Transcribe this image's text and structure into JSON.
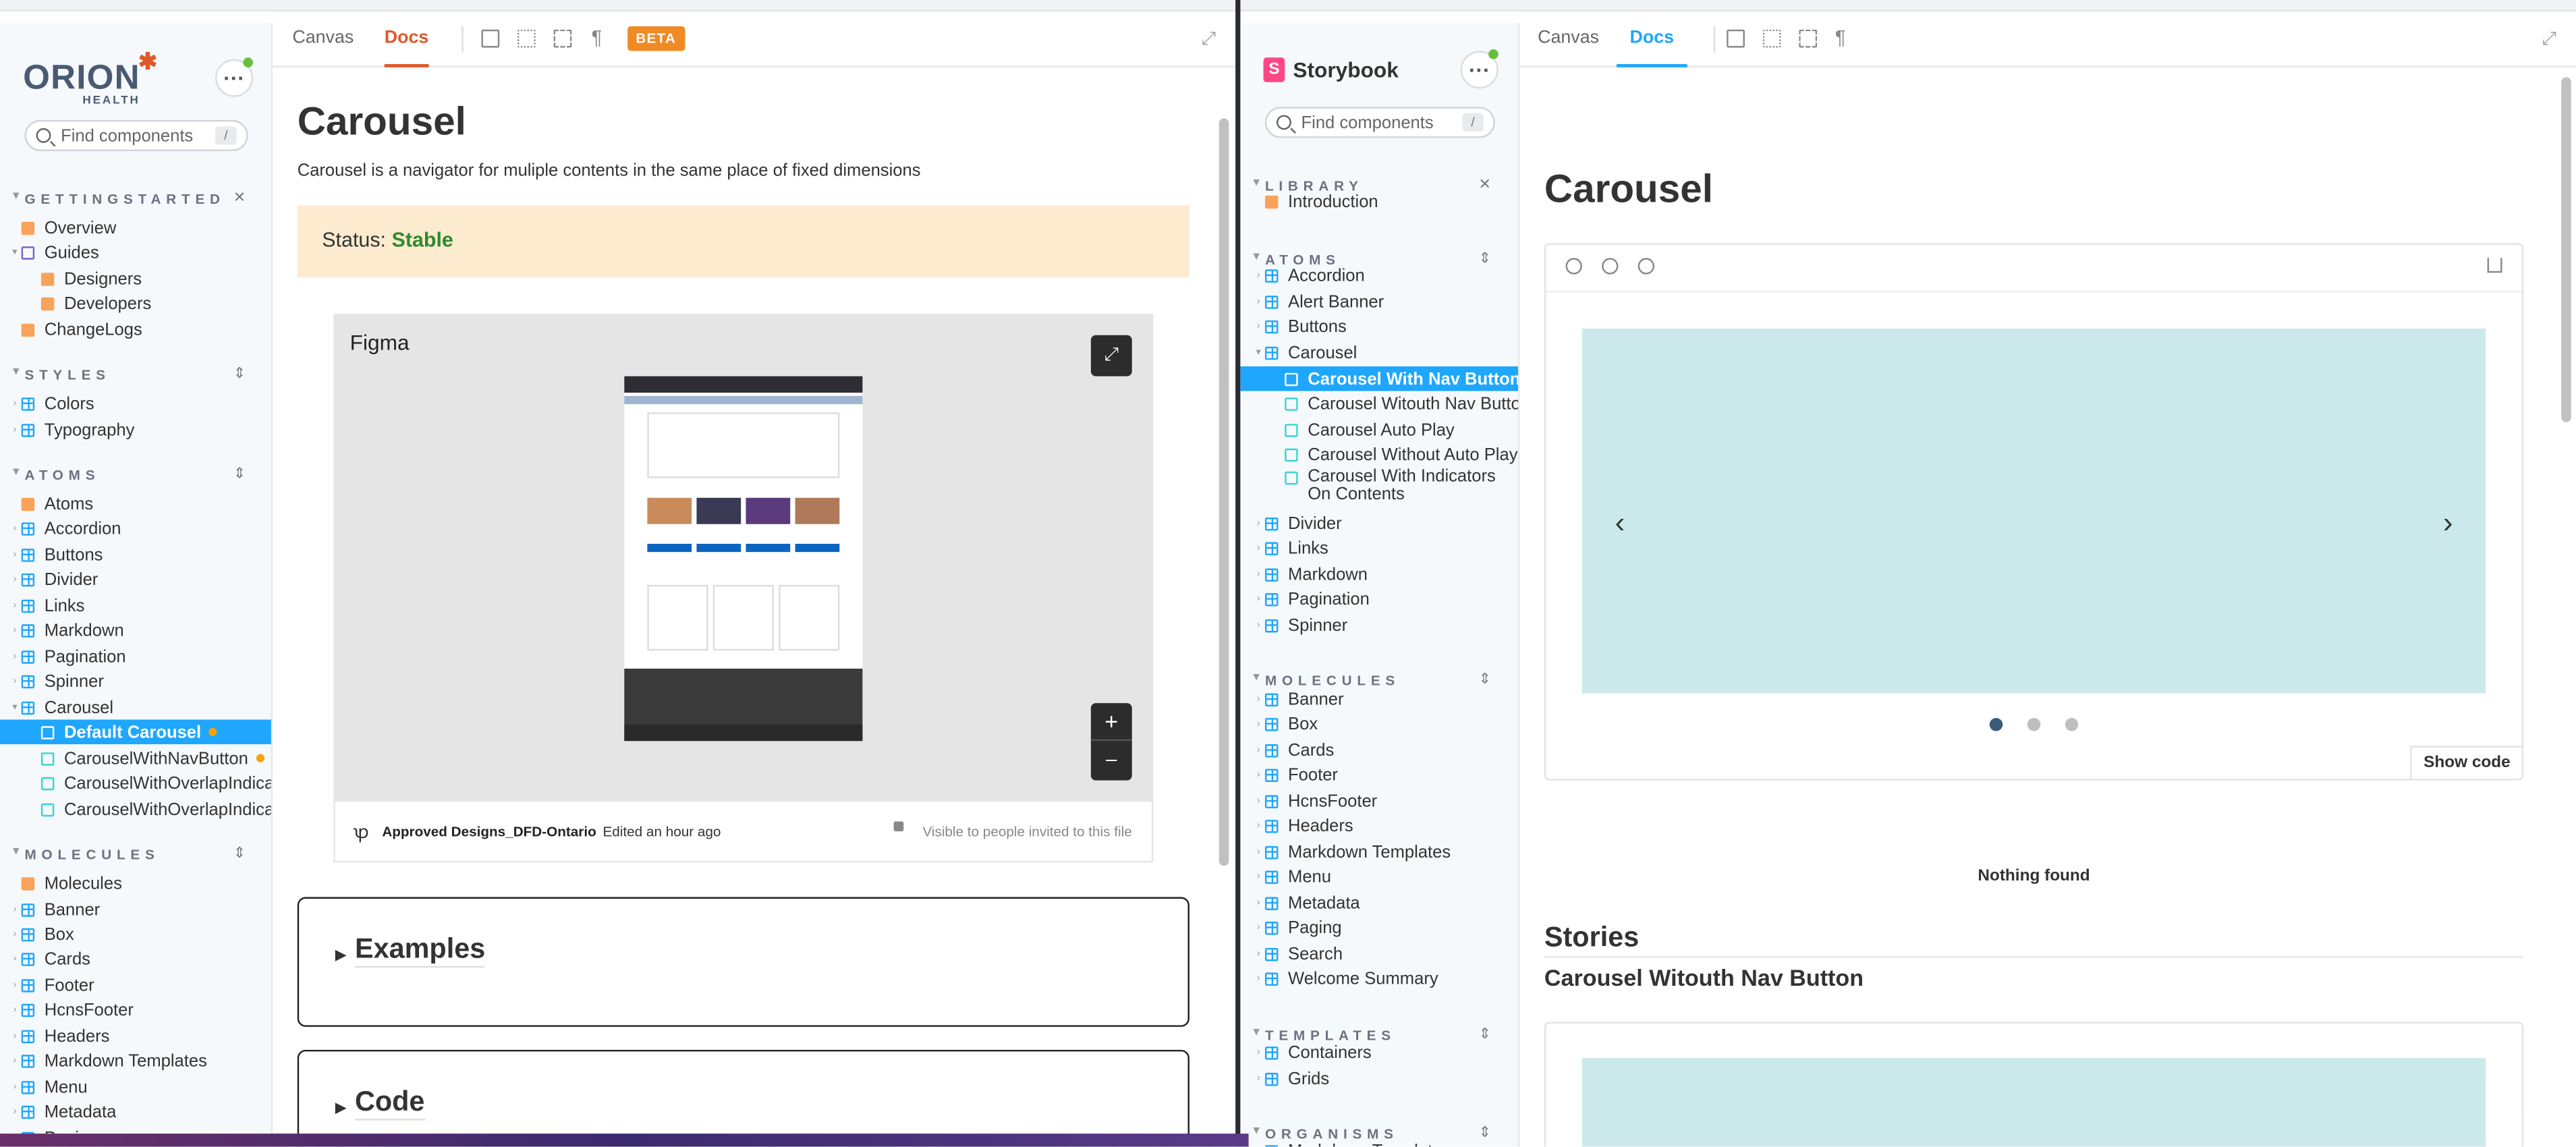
{
  "left": {
    "logo_text": "ORION",
    "logo_sub": "HEALTH",
    "search_placeholder": "Find components",
    "search_shortcut": "/",
    "tabs": {
      "canvas": "Canvas",
      "docs": "Docs"
    },
    "beta_badge": "BETA",
    "sections": [
      {
        "title": "GETTINGSTARTED",
        "items": [
          {
            "label": "Overview",
            "icon": "doc-icon"
          },
          {
            "label": "Guides",
            "icon": "folder-icon"
          },
          {
            "label": "Designers",
            "icon": "doc-icon"
          },
          {
            "label": "Developers",
            "icon": "doc-icon"
          },
          {
            "label": "ChangeLogs",
            "icon": "doc-icon"
          }
        ]
      },
      {
        "title": "STYLES",
        "items": [
          {
            "label": "Colors",
            "icon": "component-icon"
          },
          {
            "label": "Typography",
            "icon": "component-icon"
          }
        ]
      },
      {
        "title": "ATOMS",
        "items": [
          {
            "label": "Atoms",
            "icon": "doc-icon"
          },
          {
            "label": "Accordion",
            "icon": "component-icon"
          },
          {
            "label": "Buttons",
            "icon": "component-icon"
          },
          {
            "label": "Divider",
            "icon": "component-icon"
          },
          {
            "label": "Links",
            "icon": "component-icon"
          },
          {
            "label": "Markdown",
            "icon": "component-icon"
          },
          {
            "label": "Pagination",
            "icon": "component-icon"
          },
          {
            "label": "Spinner",
            "icon": "component-icon"
          },
          {
            "label": "Carousel",
            "icon": "component-icon"
          },
          {
            "label": "Default Carousel",
            "icon": "story-icon"
          },
          {
            "label": "CarouselWithNavButton",
            "icon": "story-icon"
          },
          {
            "label": "CarouselWithOverlapIndicato",
            "icon": "story-icon"
          },
          {
            "label": "CarouselWithOverlapIndicato",
            "icon": "story-icon"
          }
        ]
      },
      {
        "title": "MOLECULES",
        "items": [
          {
            "label": "Molecules",
            "icon": "doc-icon"
          },
          {
            "label": "Banner",
            "icon": "component-icon"
          },
          {
            "label": "Box",
            "icon": "component-icon"
          },
          {
            "label": "Cards",
            "icon": "component-icon"
          },
          {
            "label": "Footer",
            "icon": "component-icon"
          },
          {
            "label": "HcnsFooter",
            "icon": "component-icon"
          },
          {
            "label": "Headers",
            "icon": "component-icon"
          },
          {
            "label": "Markdown Templates",
            "icon": "component-icon"
          },
          {
            "label": "Menu",
            "icon": "component-icon"
          },
          {
            "label": "Metadata",
            "icon": "component-icon"
          },
          {
            "label": "Paging",
            "icon": "component-icon"
          }
        ]
      }
    ],
    "doc": {
      "title": "Carousel",
      "description": "Carousel is a navigator for muliple contents in the same place of fixed dimensions",
      "status_label": "Status:",
      "status_value": "Stable",
      "figma_title": "Figma",
      "figma_file": "Approved Designs_DFD-Ontario",
      "figma_edited": "Edited an hour ago",
      "figma_visibility": "Visible to people invited to this file",
      "zoom_in": "+",
      "zoom_out": "–",
      "examples_heading": "Examples",
      "code_heading": "Code"
    }
  },
  "right": {
    "logo_text": "Storybook",
    "search_placeholder": "Find components",
    "search_shortcut": "/",
    "tabs": {
      "canvas": "Canvas",
      "docs": "Docs"
    },
    "sections": [
      {
        "title": "LIBRARY",
        "items": [
          {
            "label": "Introduction",
            "icon": "doc-icon"
          }
        ]
      },
      {
        "title": "ATOMS",
        "items": [
          {
            "label": "Accordion",
            "icon": "component-icon"
          },
          {
            "label": "Alert Banner",
            "icon": "component-icon"
          },
          {
            "label": "Buttons",
            "icon": "component-icon"
          },
          {
            "label": "Carousel",
            "icon": "component-icon"
          },
          {
            "label": "Carousel With Nav Button",
            "icon": "story-icon"
          },
          {
            "label": "Carousel Witouth Nav Button",
            "icon": "story-icon"
          },
          {
            "label": "Carousel Auto Play",
            "icon": "story-icon"
          },
          {
            "label": "Carousel Without Auto Play",
            "icon": "story-icon"
          },
          {
            "label": "Carousel With Indicators On Contents",
            "icon": "story-icon"
          },
          {
            "label": "Divider",
            "icon": "component-icon"
          },
          {
            "label": "Links",
            "icon": "component-icon"
          },
          {
            "label": "Markdown",
            "icon": "component-icon"
          },
          {
            "label": "Pagination",
            "icon": "component-icon"
          },
          {
            "label": "Spinner",
            "icon": "component-icon"
          }
        ]
      },
      {
        "title": "MOLECULES",
        "items": [
          {
            "label": "Banner",
            "icon": "component-icon"
          },
          {
            "label": "Box",
            "icon": "component-icon"
          },
          {
            "label": "Cards",
            "icon": "component-icon"
          },
          {
            "label": "Footer",
            "icon": "component-icon"
          },
          {
            "label": "HcnsFooter",
            "icon": "component-icon"
          },
          {
            "label": "Headers",
            "icon": "component-icon"
          },
          {
            "label": "Markdown Templates",
            "icon": "component-icon"
          },
          {
            "label": "Menu",
            "icon": "component-icon"
          },
          {
            "label": "Metadata",
            "icon": "component-icon"
          },
          {
            "label": "Paging",
            "icon": "component-icon"
          },
          {
            "label": "Search",
            "icon": "component-icon"
          },
          {
            "label": "Welcome Summary",
            "icon": "component-icon"
          }
        ]
      },
      {
        "title": "TEMPLATES",
        "items": [
          {
            "label": "Containers",
            "icon": "component-icon"
          },
          {
            "label": "Grids",
            "icon": "component-icon"
          }
        ]
      },
      {
        "title": "ORGANISMS",
        "items": [
          {
            "label": "Markdown Templates",
            "icon": "component-icon"
          }
        ]
      }
    ],
    "doc": {
      "title": "Carousel",
      "show_code": "Show code",
      "nothing_found": "Nothing found",
      "stories_heading": "Stories",
      "story_title": "Carousel Witouth Nav Button",
      "prev_arrow": "‹",
      "next_arrow": "›"
    }
  },
  "colors": {
    "orion_accent": "#e0582a",
    "storybook_accent": "#1ea7fd",
    "status_bg": "#fdebd0",
    "status_green": "#2e8b2e",
    "carousel_bg": "#cbe9ea"
  }
}
